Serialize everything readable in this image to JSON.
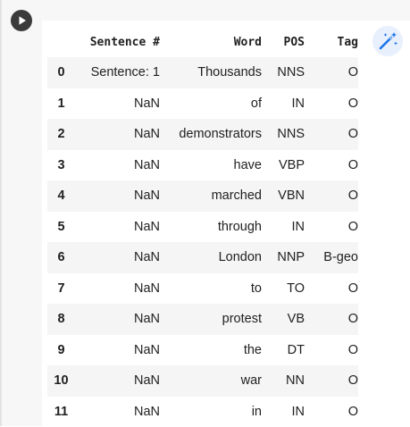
{
  "table": {
    "columns": [
      "",
      "Sentence #",
      "Word",
      "POS",
      "Tag"
    ],
    "rows": [
      {
        "index": "0",
        "sentence": "Sentence: 1",
        "word": "Thousands",
        "pos": "NNS",
        "tag": "O"
      },
      {
        "index": "1",
        "sentence": "NaN",
        "word": "of",
        "pos": "IN",
        "tag": "O"
      },
      {
        "index": "2",
        "sentence": "NaN",
        "word": "demonstrators",
        "pos": "NNS",
        "tag": "O"
      },
      {
        "index": "3",
        "sentence": "NaN",
        "word": "have",
        "pos": "VBP",
        "tag": "O"
      },
      {
        "index": "4",
        "sentence": "NaN",
        "word": "marched",
        "pos": "VBN",
        "tag": "O"
      },
      {
        "index": "5",
        "sentence": "NaN",
        "word": "through",
        "pos": "IN",
        "tag": "O"
      },
      {
        "index": "6",
        "sentence": "NaN",
        "word": "London",
        "pos": "NNP",
        "tag": "B-geo"
      },
      {
        "index": "7",
        "sentence": "NaN",
        "word": "to",
        "pos": "TO",
        "tag": "O"
      },
      {
        "index": "8",
        "sentence": "NaN",
        "word": "protest",
        "pos": "VB",
        "tag": "O"
      },
      {
        "index": "9",
        "sentence": "NaN",
        "word": "the",
        "pos": "DT",
        "tag": "O"
      },
      {
        "index": "10",
        "sentence": "NaN",
        "word": "war",
        "pos": "NN",
        "tag": "O"
      },
      {
        "index": "11",
        "sentence": "NaN",
        "word": "in",
        "pos": "IN",
        "tag": "O"
      }
    ]
  },
  "icons": {
    "run": "play-icon",
    "magic": "magic-wand-icon"
  },
  "colors": {
    "run_button": "#3b3b3b",
    "magic_button_bg": "#e8f0fe",
    "magic_icon": "#1a73e8",
    "striped_row": "#f5f5f5"
  }
}
